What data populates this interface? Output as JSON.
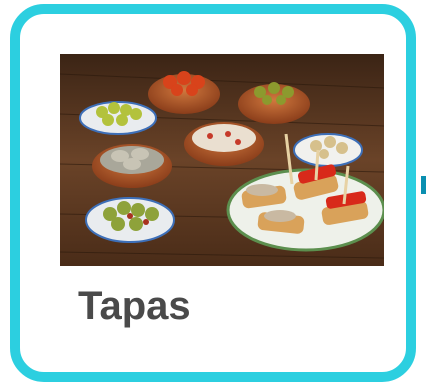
{
  "card": {
    "title": "Tapas",
    "border_color": "#2ccfe0",
    "image_subject": "tapas-food-photo"
  }
}
